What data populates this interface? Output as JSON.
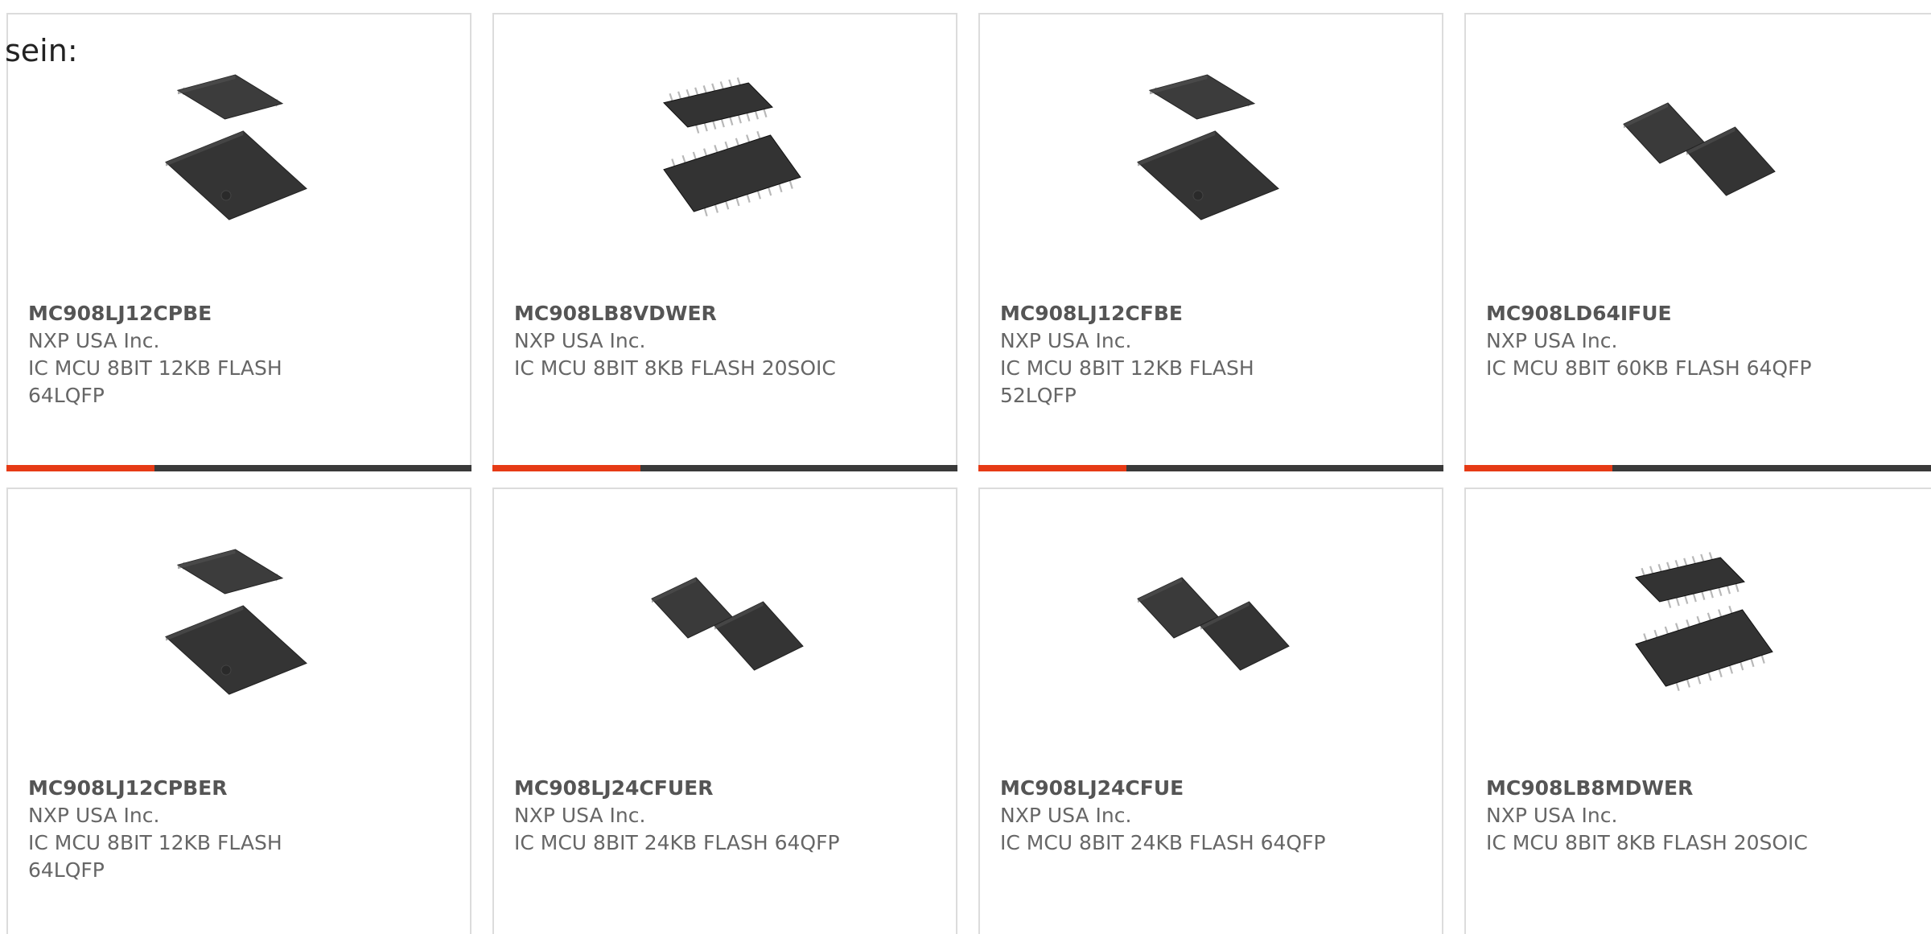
{
  "intro_text": "sein:",
  "colors": {
    "accent": "#e63b16",
    "bar_dark": "#3a3a3a",
    "border": "#dcdcdc",
    "text": "#666666"
  },
  "products": [
    {
      "part_number": "MC908LJ12CPBE",
      "manufacturer": "NXP USA Inc.",
      "description": "IC MCU 8BIT 12KB FLASH 64LQFP",
      "image": "qfp-pair-stacked-icon"
    },
    {
      "part_number": "MC908LB8VDWER",
      "manufacturer": "NXP USA Inc.",
      "description": "IC MCU 8BIT 8KB FLASH 20SOIC",
      "image": "soic-pair-icon"
    },
    {
      "part_number": "MC908LJ12CFBE",
      "manufacturer": "NXP USA Inc.",
      "description": "IC MCU 8BIT 12KB FLASH 52LQFP",
      "image": "qfp-pair-stacked-icon"
    },
    {
      "part_number": "MC908LD64IFUE",
      "manufacturer": "NXP USA Inc.",
      "description": "IC MCU 8BIT 60KB FLASH 64QFP",
      "image": "qfp-pair-side-icon"
    },
    {
      "part_number": "MC908LJ12CPBER",
      "manufacturer": "NXP USA Inc.",
      "description": "IC MCU 8BIT 12KB FLASH 64LQFP",
      "image": "qfp-pair-stacked-icon"
    },
    {
      "part_number": "MC908LJ24CFUER",
      "manufacturer": "NXP USA Inc.",
      "description": "IC MCU 8BIT 24KB FLASH 64QFP",
      "image": "qfp-pair-side-icon"
    },
    {
      "part_number": "MC908LJ24CFUE",
      "manufacturer": "NXP USA Inc.",
      "description": "IC MCU 8BIT 24KB FLASH 64QFP",
      "image": "qfp-pair-side-icon"
    },
    {
      "part_number": "MC908LB8MDWER",
      "manufacturer": "NXP USA Inc.",
      "description": "IC MCU 8BIT 8KB FLASH 20SOIC",
      "image": "soic-pair-icon"
    }
  ]
}
